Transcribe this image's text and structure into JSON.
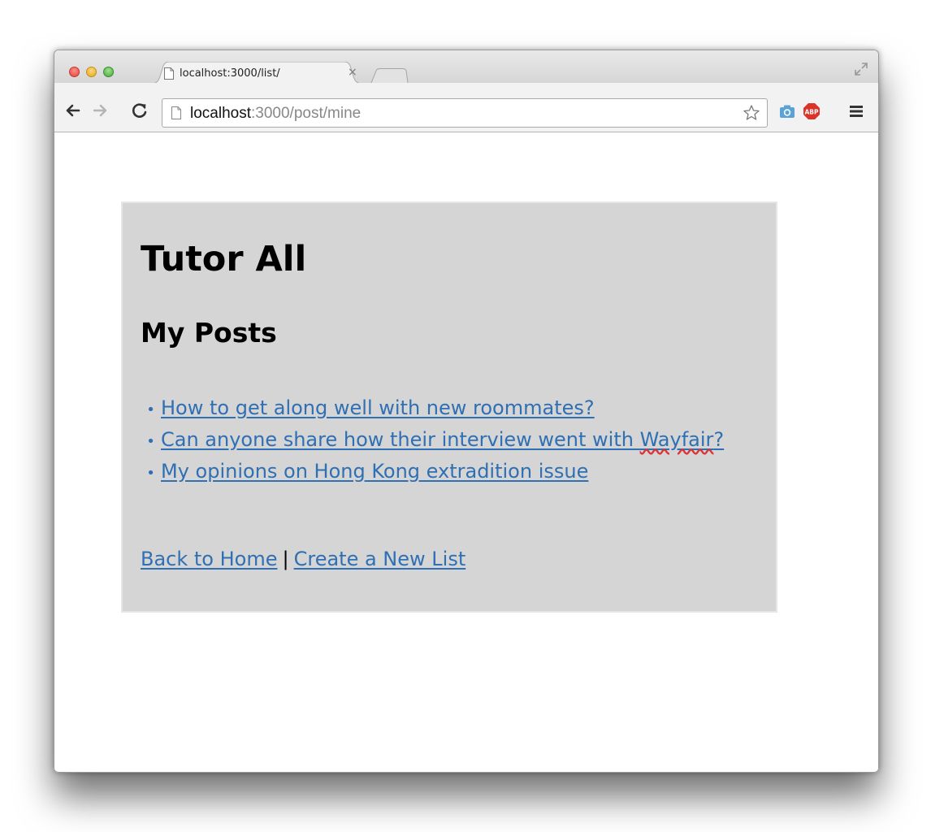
{
  "browser": {
    "tab": {
      "title": "localhost:3000/list/",
      "close_label": "×"
    },
    "address_bar": {
      "host": "localhost",
      "port": ":3000",
      "path": "/post/mine"
    },
    "icons": {
      "traffic_lights": [
        "close-button",
        "minimize-button",
        "zoom-button"
      ],
      "nav": [
        "back-arrow-icon",
        "forward-arrow-icon",
        "reload-icon"
      ],
      "toolbar": [
        "bookmark-star-icon",
        "camera-extension-icon",
        "adblock-plus-icon",
        "menu-icon"
      ],
      "adblock_text": "ABP"
    },
    "colors": {
      "link": "#2f6fb3",
      "panel_bg": "#d5d5d5",
      "abp_red": "#d9332a",
      "camera_blue": "#5ba3d6"
    }
  },
  "page": {
    "site_title": "Tutor All",
    "section_title": "My Posts",
    "posts": [
      {
        "text": "How to get along well with new roommates?"
      },
      {
        "text_before": "Can anyone share how their interview went with ",
        "misspelled": "Wayfair",
        "text_after": "?"
      },
      {
        "text": "My opinions on Hong Kong extradition issue"
      }
    ],
    "footer": {
      "home_link": "Back to Home",
      "separator": "|",
      "create_link": "Create a New List"
    }
  }
}
